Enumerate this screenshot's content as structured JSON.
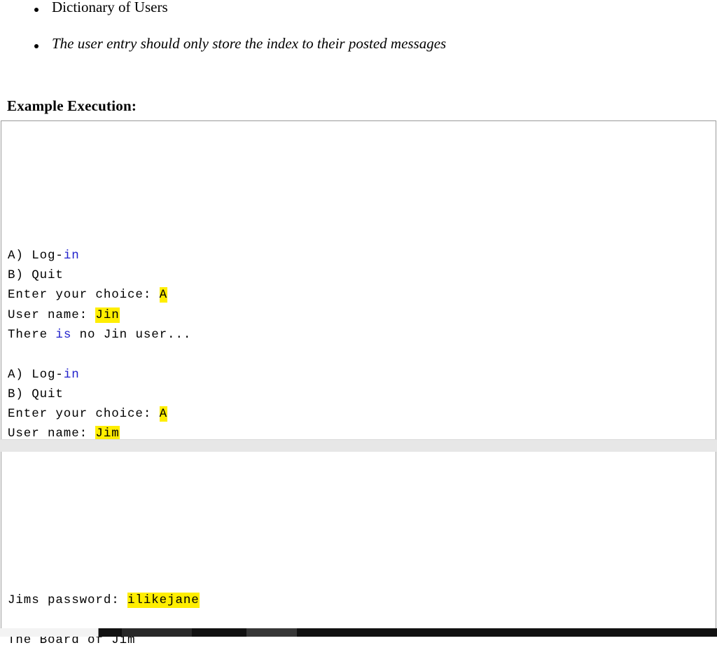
{
  "document": {
    "bullets": [
      {
        "text": "Dictionary of Users",
        "style": "normal"
      },
      {
        "text": "The user entry should only store the index to their posted messages",
        "style": "italic"
      }
    ],
    "heading": "Example Execution:"
  },
  "code_block_one": {
    "lines": [
      {
        "segments": [
          {
            "t": "A) Log-",
            "k": "plain"
          },
          {
            "t": "in",
            "k": "keyword"
          }
        ]
      },
      {
        "segments": [
          {
            "t": "B) Quit",
            "k": "plain"
          }
        ]
      },
      {
        "segments": [
          {
            "t": "Enter your choice: ",
            "k": "plain"
          },
          {
            "t": "A",
            "k": "highlight"
          }
        ]
      },
      {
        "segments": [
          {
            "t": "User name: ",
            "k": "plain"
          },
          {
            "t": "Jin",
            "k": "highlight"
          }
        ]
      },
      {
        "segments": [
          {
            "t": "There ",
            "k": "plain"
          },
          {
            "t": "is",
            "k": "keyword"
          },
          {
            "t": " no Jin user...",
            "k": "plain"
          }
        ]
      },
      {
        "segments": [
          {
            "t": "",
            "k": "plain"
          }
        ]
      },
      {
        "segments": [
          {
            "t": "A) Log-",
            "k": "plain"
          },
          {
            "t": "in",
            "k": "keyword"
          }
        ]
      },
      {
        "segments": [
          {
            "t": "B) Quit",
            "k": "plain"
          }
        ]
      },
      {
        "segments": [
          {
            "t": "Enter your choice: ",
            "k": "plain"
          },
          {
            "t": "A",
            "k": "highlight"
          }
        ]
      },
      {
        "segments": [
          {
            "t": "User name: ",
            "k": "plain"
          },
          {
            "t": "Jim",
            "k": "highlight"
          }
        ]
      }
    ]
  },
  "code_block_two": {
    "lines": [
      {
        "segments": [
          {
            "t": "",
            "k": "plain"
          }
        ]
      },
      {
        "segments": [
          {
            "t": "",
            "k": "plain"
          }
        ]
      },
      {
        "segments": [
          {
            "t": "",
            "k": "plain"
          }
        ]
      },
      {
        "segments": [
          {
            "t": "",
            "k": "plain"
          }
        ]
      },
      {
        "segments": [
          {
            "t": "",
            "k": "plain"
          }
        ]
      },
      {
        "segments": [
          {
            "t": "Jims password: ",
            "k": "plain"
          },
          {
            "t": "ilikejane",
            "k": "highlight"
          }
        ]
      },
      {
        "segments": [
          {
            "t": "",
            "k": "plain"
          }
        ]
      },
      {
        "segments": [
          {
            "t": "The Board of Jim",
            "k": "plain"
          }
        ]
      }
    ]
  },
  "colors": {
    "keyword": "#2222cc",
    "highlight_bg": "#ffee00",
    "text": "#000000",
    "code_border": "#9a9a9a",
    "page_gap": "#e7e7e7",
    "scrollbar_track": "#111111",
    "scrollbar_thumb": "#f3f3f3"
  },
  "scrollbar": {
    "orientation": "horizontal",
    "thumb_position": "left"
  }
}
